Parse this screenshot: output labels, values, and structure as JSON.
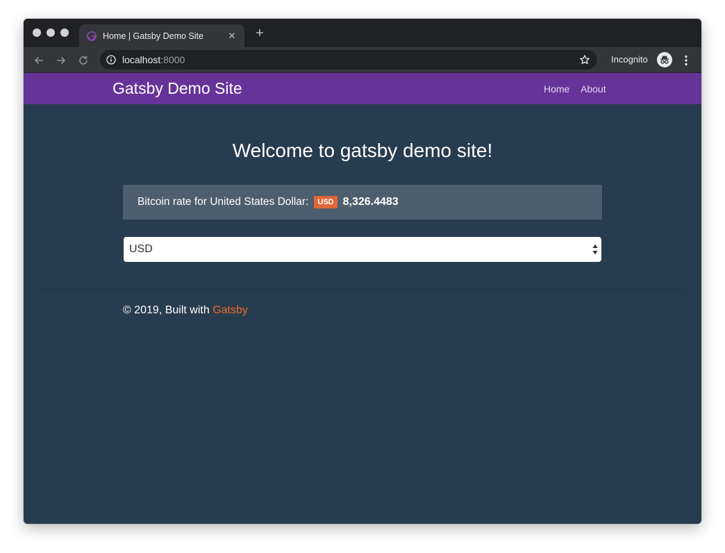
{
  "browser": {
    "tab_title": "Home | Gatsby Demo Site",
    "url_host": "localhost",
    "url_port": ":8000",
    "incognito_label": "Incognito"
  },
  "site": {
    "title": "Gatsby Demo Site",
    "nav": {
      "home": "Home",
      "about": "About"
    },
    "heading": "Welcome to gatsby demo site!",
    "rate": {
      "label": "Bitcoin rate for United States Dollar:",
      "currency_code": "USD",
      "value": "8,326.4483"
    },
    "select": {
      "selected": "USD"
    },
    "footer": {
      "text": "© 2019, Built with ",
      "link": "Gatsby"
    }
  },
  "colors": {
    "header_bg": "#663399",
    "page_bg": "#283c4f",
    "badge_bg": "#e0673a",
    "link": "#f06a2c"
  }
}
